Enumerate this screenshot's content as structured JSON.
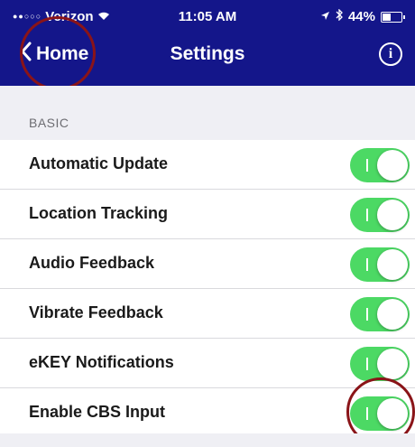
{
  "status_bar": {
    "signal": "●●○○○",
    "carrier": "Verizon",
    "time": "11:05 AM",
    "battery_text": "44%",
    "battery_level": 0.44
  },
  "nav": {
    "back_label": "Home",
    "title": "Settings",
    "info_glyph": "i"
  },
  "section": {
    "header": "BASIC"
  },
  "settings": [
    {
      "label": "Automatic Update",
      "enabled": true
    },
    {
      "label": "Location Tracking",
      "enabled": true
    },
    {
      "label": "Audio Feedback",
      "enabled": true
    },
    {
      "label": "Vibrate Feedback",
      "enabled": true
    },
    {
      "label": "eKEY Notifications",
      "enabled": true
    },
    {
      "label": "Enable CBS Input",
      "enabled": true
    }
  ],
  "colors": {
    "nav_background": "#14168a",
    "toggle_on": "#4cd964",
    "highlight_ring": "#8a1418"
  }
}
